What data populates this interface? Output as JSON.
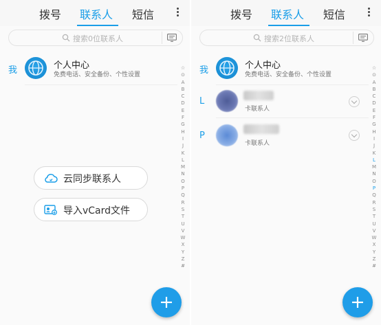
{
  "screens": [
    {
      "tabs": {
        "dial": "拨号",
        "contacts": "联系人",
        "messages": "短信"
      },
      "search": {
        "placeholder": "搜索0位联系人"
      },
      "me_row": {
        "letter": "我",
        "title": "个人中心",
        "subtitle": "免费电话、安全备份、个性设置"
      },
      "actions": {
        "cloud_sync": "云同步联系人",
        "import_vcard": "导入vCard文件"
      }
    },
    {
      "tabs": {
        "dial": "拨号",
        "contacts": "联系人",
        "messages": "短信"
      },
      "search": {
        "placeholder": "搜索2位联系人"
      },
      "me_row": {
        "letter": "我",
        "title": "个人中心",
        "subtitle": "免费电话、安全备份、个性设置"
      },
      "contacts": [
        {
          "letter": "L",
          "subtitle": "卡联系人"
        },
        {
          "letter": "P",
          "subtitle": "卡联系人"
        }
      ]
    }
  ],
  "index_letters": [
    "☆",
    "⊙",
    "A",
    "B",
    "C",
    "D",
    "E",
    "F",
    "G",
    "H",
    "I",
    "J",
    "K",
    "L",
    "M",
    "N",
    "O",
    "P",
    "Q",
    "R",
    "S",
    "T",
    "U",
    "V",
    "W",
    "X",
    "Y",
    "Z",
    "#"
  ],
  "colors": {
    "accent": "#1a9ee8",
    "fab": "#1f9de8"
  }
}
